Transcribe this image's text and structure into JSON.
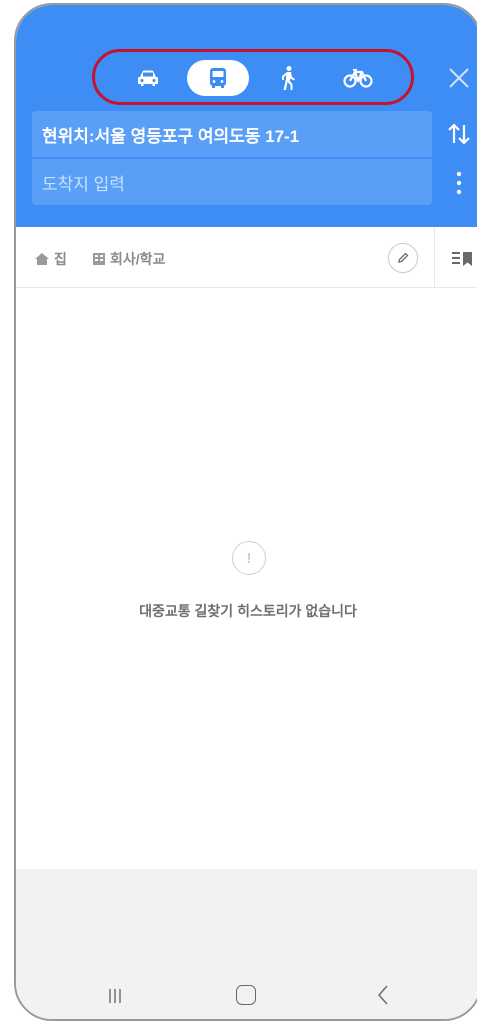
{
  "header": {
    "modes": [
      {
        "name": "car",
        "icon": "car-icon",
        "active": false
      },
      {
        "name": "bus",
        "icon": "bus-icon",
        "active": true
      },
      {
        "name": "walk",
        "icon": "walk-icon",
        "active": false
      },
      {
        "name": "bike",
        "icon": "bike-icon",
        "active": false
      }
    ],
    "origin": "현위치:서울 영등포구 여의도동 17-1",
    "destination_placeholder": "도착지 입력"
  },
  "favorites": {
    "home_label": "집",
    "work_label": "회사/학교"
  },
  "empty_state": {
    "icon_glyph": "!",
    "message": "대중교통 길찾기 히스토리가 없습니다"
  },
  "colors": {
    "header_blue": "#3d8df5",
    "field_blue": "#5a9ff7",
    "highlight_red": "#c4132c"
  }
}
